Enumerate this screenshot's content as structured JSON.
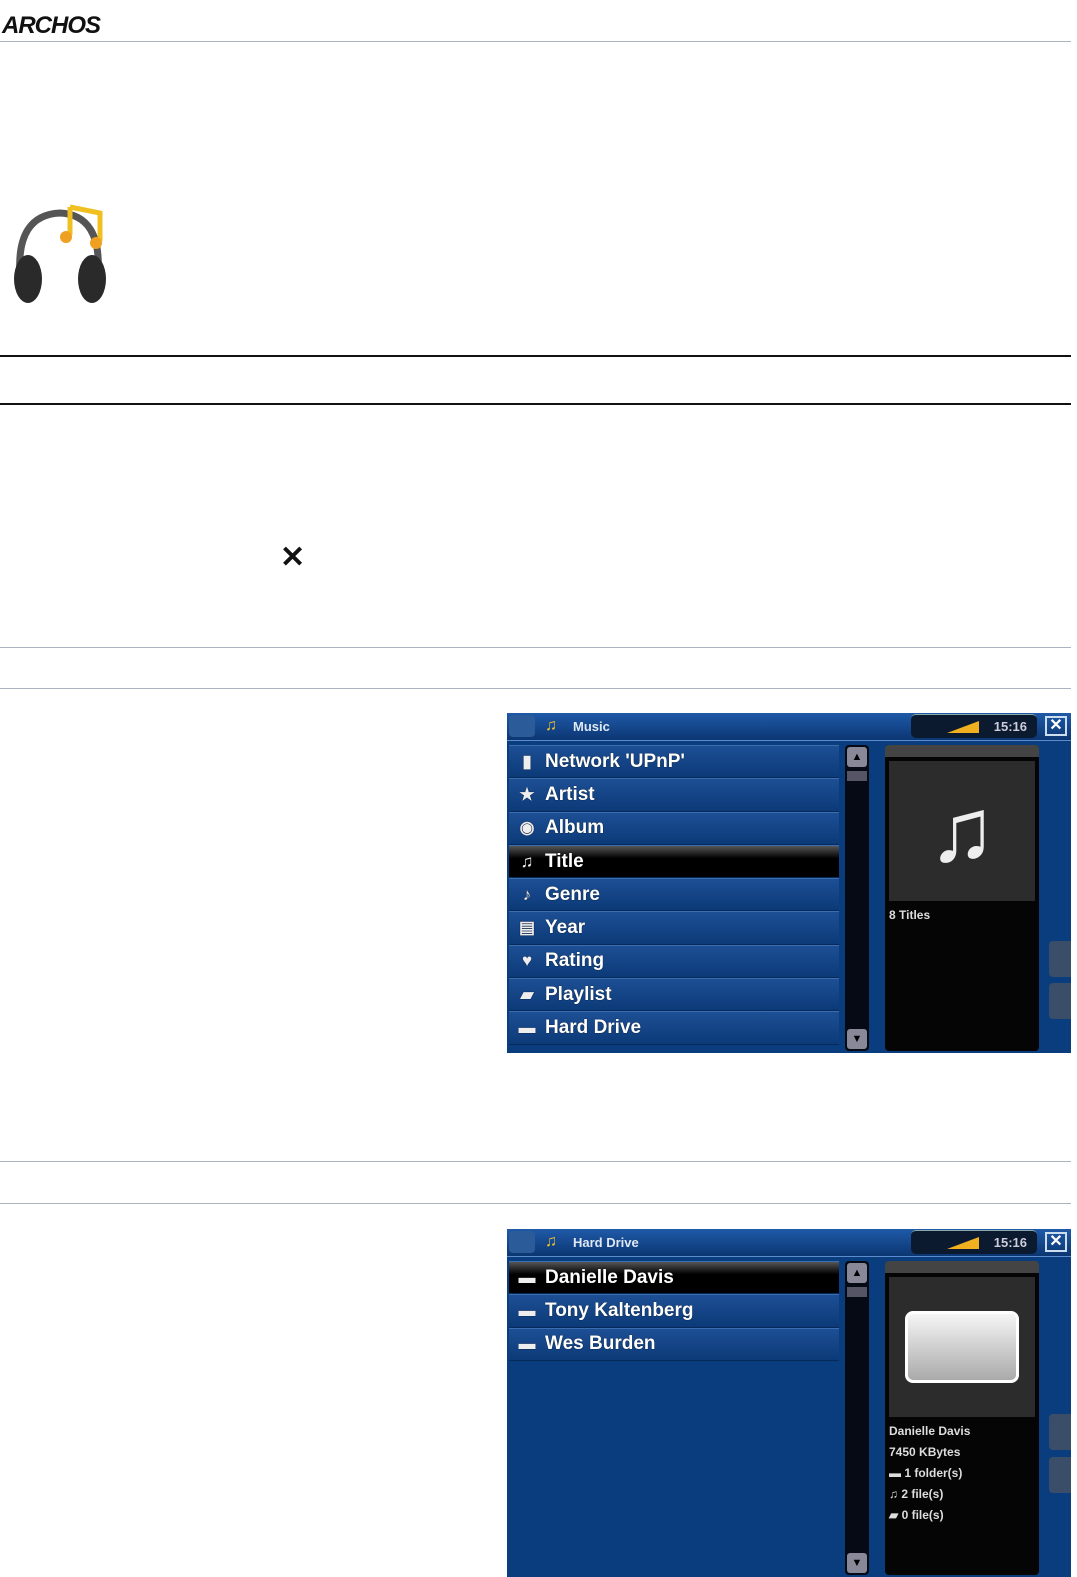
{
  "header": {
    "logo": "ARCHOS"
  },
  "page": {
    "close_glyph": "✕"
  },
  "screens": [
    {
      "title": "Music",
      "time": "15:16",
      "close": "✕",
      "items": [
        {
          "icon": "network-icon",
          "glyph": "▮",
          "label": "Network 'UPnP'"
        },
        {
          "icon": "star-icon",
          "glyph": "★",
          "label": "Artist"
        },
        {
          "icon": "disc-icon",
          "glyph": "◉",
          "label": "Album"
        },
        {
          "icon": "music-note-icon",
          "glyph": "♫",
          "label": "Title"
        },
        {
          "icon": "genre-icon",
          "glyph": "♪",
          "label": "Genre"
        },
        {
          "icon": "calendar-icon",
          "glyph": "▤",
          "label": "Year"
        },
        {
          "icon": "heart-icon",
          "glyph": "♥",
          "label": "Rating"
        },
        {
          "icon": "playlist-icon",
          "glyph": "▰",
          "label": "Playlist"
        },
        {
          "icon": "folder-icon",
          "glyph": "▬",
          "label": "Hard Drive"
        }
      ],
      "selected": 3,
      "info": [
        "8 Titles"
      ]
    },
    {
      "title": "Hard Drive",
      "time": "15:16",
      "close": "✕",
      "items": [
        {
          "icon": "folder-open-icon",
          "glyph": "▬",
          "label": "Danielle Davis"
        },
        {
          "icon": "folder-icon",
          "glyph": "▬",
          "label": "Tony Kaltenberg"
        },
        {
          "icon": "folder-icon",
          "glyph": "▬",
          "label": "Wes Burden"
        }
      ],
      "selected": 0,
      "info": [
        "Danielle Davis",
        "7450 KBytes",
        "▬ 1 folder(s)",
        "♫ 2 file(s)",
        "▰ 0 file(s)"
      ]
    }
  ],
  "colors": {
    "screen_bg": "#0a3d7e",
    "accent": "#f0b020"
  }
}
